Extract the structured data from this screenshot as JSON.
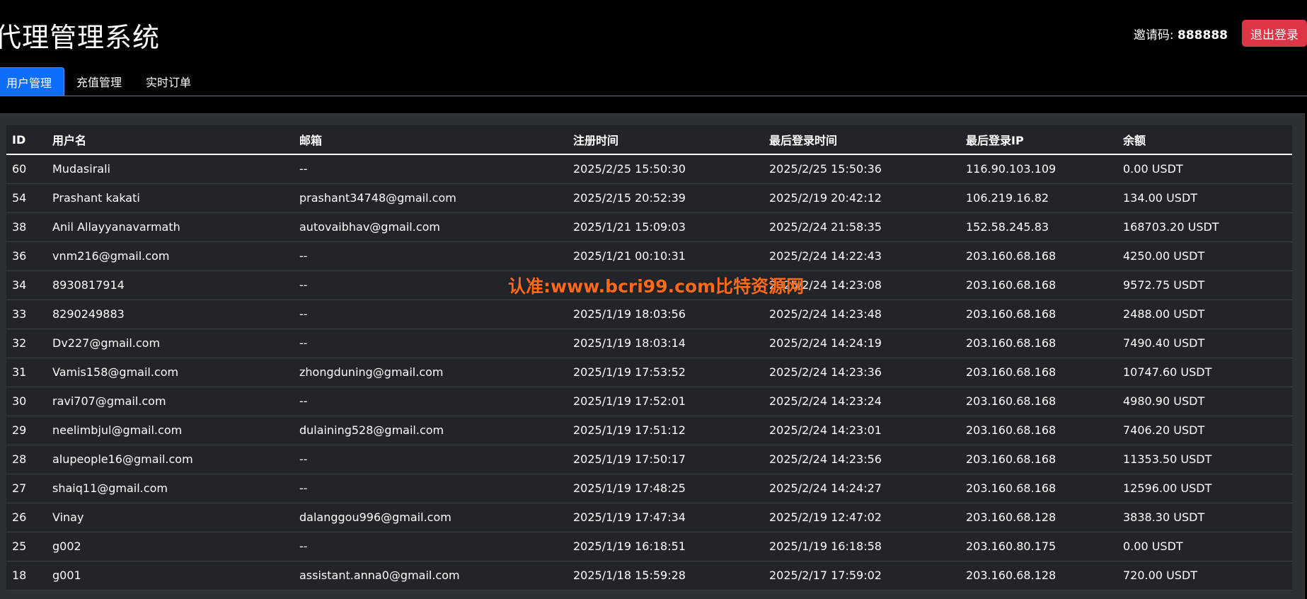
{
  "header": {
    "title": "代理管理系统",
    "invite_label": "邀请码:",
    "invite_code": "888888",
    "logout_label": "退出登录"
  },
  "tabs": [
    {
      "label": "用户管理",
      "active": true
    },
    {
      "label": "充值管理",
      "active": false
    },
    {
      "label": "实时订单",
      "active": false
    }
  ],
  "table": {
    "columns": [
      "ID",
      "用户名",
      "邮箱",
      "注册时间",
      "最后登录时间",
      "最后登录IP",
      "余额"
    ],
    "rows": [
      [
        "60",
        "Mudasirali",
        "--",
        "2025/2/25 15:50:30",
        "2025/2/25 15:50:36",
        "116.90.103.109",
        "0.00 USDT"
      ],
      [
        "54",
        "Prashant kakati",
        "prashant34748@gmail.com",
        "2025/2/15 20:52:39",
        "2025/2/19 20:42:12",
        "106.219.16.82",
        "134.00 USDT"
      ],
      [
        "38",
        "Anil Allayyanavarmath",
        "autovaibhav@gmail.com",
        "2025/1/21 15:09:03",
        "2025/2/24 21:58:35",
        "152.58.245.83",
        "168703.20 USDT"
      ],
      [
        "36",
        "vnm216@gmail.com",
        "--",
        "2025/1/21 00:10:31",
        "2025/2/24 14:22:43",
        "203.160.68.168",
        "4250.00 USDT"
      ],
      [
        "34",
        "8930817914",
        "--",
        "",
        "2025/2/24 14:23:08",
        "203.160.68.168",
        "9572.75 USDT"
      ],
      [
        "33",
        "8290249883",
        "--",
        "2025/1/19 18:03:56",
        "2025/2/24 14:23:48",
        "203.160.68.168",
        "2488.00 USDT"
      ],
      [
        "32",
        "Dv227@gmail.com",
        "--",
        "2025/1/19 18:03:14",
        "2025/2/24 14:24:19",
        "203.160.68.168",
        "7490.40 USDT"
      ],
      [
        "31",
        "Vamis158@gmail.com",
        "zhongduning@gmail.com",
        "2025/1/19 17:53:52",
        "2025/2/24 14:23:36",
        "203.160.68.168",
        "10747.60 USDT"
      ],
      [
        "30",
        "ravi707@gmail.com",
        "--",
        "2025/1/19 17:52:01",
        "2025/2/24 14:23:24",
        "203.160.68.168",
        "4980.90 USDT"
      ],
      [
        "29",
        "neelimbjul@gmail.com",
        "dulaining528@gmail.com",
        "2025/1/19 17:51:12",
        "2025/2/24 14:23:01",
        "203.160.68.168",
        "7406.20 USDT"
      ],
      [
        "28",
        "alupeople16@gmail.com",
        "--",
        "2025/1/19 17:50:17",
        "2025/2/24 14:23:56",
        "203.160.68.168",
        "11353.50 USDT"
      ],
      [
        "27",
        "shaiq11@gmail.com",
        "--",
        "2025/1/19 17:48:25",
        "2025/2/24 14:24:27",
        "203.160.68.168",
        "12596.00 USDT"
      ],
      [
        "26",
        "Vinay",
        "dalanggou996@gmail.com",
        "2025/1/19 17:47:34",
        "2025/2/19 12:47:02",
        "203.160.68.128",
        "3838.30 USDT"
      ],
      [
        "25",
        "g002",
        "--",
        "2025/1/19 16:18:51",
        "2025/1/19 16:18:58",
        "203.160.80.175",
        "0.00 USDT"
      ],
      [
        "18",
        "g001",
        "assistant.anna0@gmail.com",
        "2025/1/18 15:59:28",
        "2025/2/17 17:59:02",
        "203.160.68.128",
        "720.00 USDT"
      ]
    ]
  },
  "watermark": "认准:www.bcri99.com比特资源网",
  "colors": {
    "background": "#000000",
    "panel": "#2b3035",
    "table": "#212529",
    "accent": "#0d6efd",
    "danger": "#dc3545",
    "watermark": "#ff6a1a"
  }
}
